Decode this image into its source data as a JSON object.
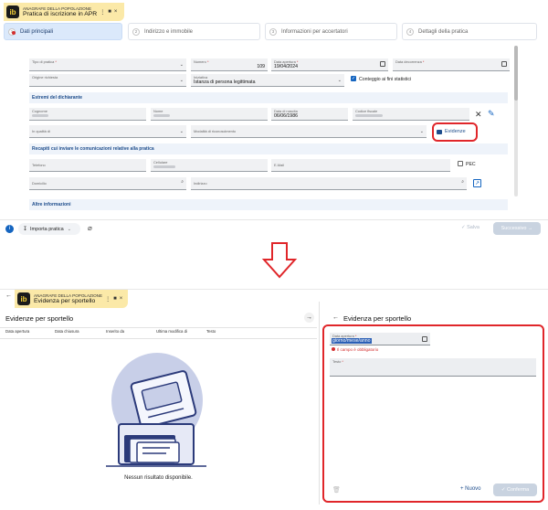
{
  "top": {
    "tab": {
      "subtitle": "ANAGRAFE DELLA POPOLAZIONE",
      "title": "Pratica di iscrizione in APR",
      "logo": "ib"
    },
    "steps": [
      {
        "num": "1",
        "label": "Dati principali"
      },
      {
        "num": "2",
        "label": "Indirizzo e immobile"
      },
      {
        "num": "3",
        "label": "Informazioni per accertatori"
      },
      {
        "num": "4",
        "label": "Dettagli della pratica"
      }
    ],
    "fields": {
      "tipo_pratica": {
        "label": "Tipo di pratica",
        "value": ""
      },
      "numero": {
        "label": "Numero",
        "value": "109"
      },
      "data_apertura": {
        "label": "Data apertura",
        "value": "19/04/2024"
      },
      "data_decorrenza": {
        "label": "Data decorrenza",
        "value": ""
      },
      "origine": {
        "label": "Origine richiesta",
        "value": ""
      },
      "iniziativa": {
        "label": "Iniziativa",
        "value": "Istanza di persona legittimata"
      },
      "conteggio": "Conteggio ai fini statistici",
      "cognome": {
        "label": "Cognome"
      },
      "nome": {
        "label": "Nome"
      },
      "data_nascita": {
        "label": "Data di nascita",
        "value": "06/06/1986"
      },
      "codice_fiscale": {
        "label": "Codice fiscale"
      },
      "in_qualita": {
        "label": "In qualità di"
      },
      "modalita": {
        "label": "Modalità di riconoscimento"
      },
      "telefono": {
        "label": "Telefono"
      },
      "cellulare": {
        "label": "Cellulare"
      },
      "email": {
        "label": "E-Mail"
      },
      "pec": "PEC",
      "domicilio": {
        "label": "Domicilio"
      },
      "indirizzo": {
        "label": "Indirizzo"
      }
    },
    "sections": {
      "dichiarante": "Estremi del dichiarante",
      "recapiti": "Recapiti cui inviare le comunicazioni relative alla pratica",
      "altre": "Altre informazioni"
    },
    "evidenze_button": "Evidenze",
    "bottom": {
      "importa": "Importa pratica",
      "salva": "Salva",
      "successivo": "Successivo"
    }
  },
  "bottom": {
    "tab": {
      "subtitle": "ANAGRAFE DELLA POPOLAZIONE",
      "title": "Evidenza per sportello",
      "logo": "ib"
    },
    "list_title": "Evidenze per sportello",
    "columns": [
      "Data apertura",
      "Data chiusura",
      "Inserito da",
      "Ultima modifica di",
      "Testo"
    ],
    "empty_text": "Nessun risultato disponibile.",
    "side": {
      "title": "Evidenza per sportello",
      "data_apertura_label": "Data apertura",
      "data_apertura_placeholder": "giorno/mese/anno",
      "error": "Il campo è obbligatorio",
      "testo_label": "Testo",
      "nuovo": "Nuovo",
      "conferma": "Conferma"
    }
  },
  "colors": {
    "highlight": "#e0262a",
    "accent": "#1565c0",
    "tab_bg": "#fbe9a8"
  }
}
